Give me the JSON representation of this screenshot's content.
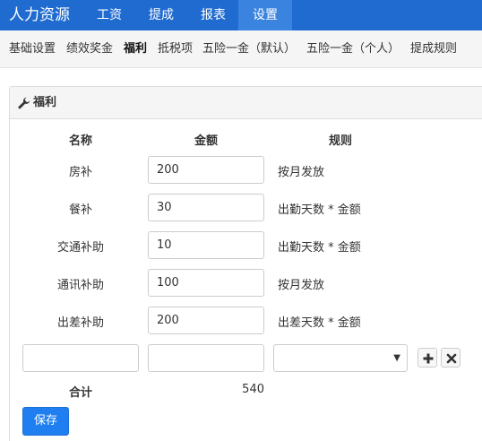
{
  "app": {
    "brand": "人力资源"
  },
  "nav": {
    "tabs": [
      {
        "label": "工资"
      },
      {
        "label": "提成"
      },
      {
        "label": "报表"
      },
      {
        "label": "设置",
        "active": true
      }
    ]
  },
  "subnav": {
    "items": [
      {
        "label": "基础设置"
      },
      {
        "label": "绩效奖金"
      },
      {
        "label": "福利",
        "active": true
      },
      {
        "label": "抵税项"
      },
      {
        "label": "五险一金（默认）"
      },
      {
        "label": "五险一金（个人）"
      },
      {
        "label": "提成规则"
      }
    ]
  },
  "panel": {
    "title": "福利",
    "icon": "wrench-icon",
    "columns": {
      "name": "名称",
      "amount": "金额",
      "rule": "规则"
    },
    "rows": [
      {
        "name": "房补",
        "amount": "200",
        "rule": "按月发放"
      },
      {
        "name": "餐补",
        "amount": "30",
        "rule": "出勤天数 * 金额"
      },
      {
        "name": "交通补助",
        "amount": "10",
        "rule": "出勤天数 * 金额"
      },
      {
        "name": "通讯补助",
        "amount": "100",
        "rule": "按月发放"
      },
      {
        "name": "出差补助",
        "amount": "200",
        "rule": "出差天数 * 金额"
      }
    ],
    "new_row": {
      "name": "",
      "amount": "",
      "rule": ""
    },
    "total_label": "合计",
    "total_value": "540",
    "save_label": "保存"
  },
  "colors": {
    "nav_bg": "#1f6bd0",
    "nav_active": "#3a83df",
    "primary_button": "#1f7ff0"
  }
}
